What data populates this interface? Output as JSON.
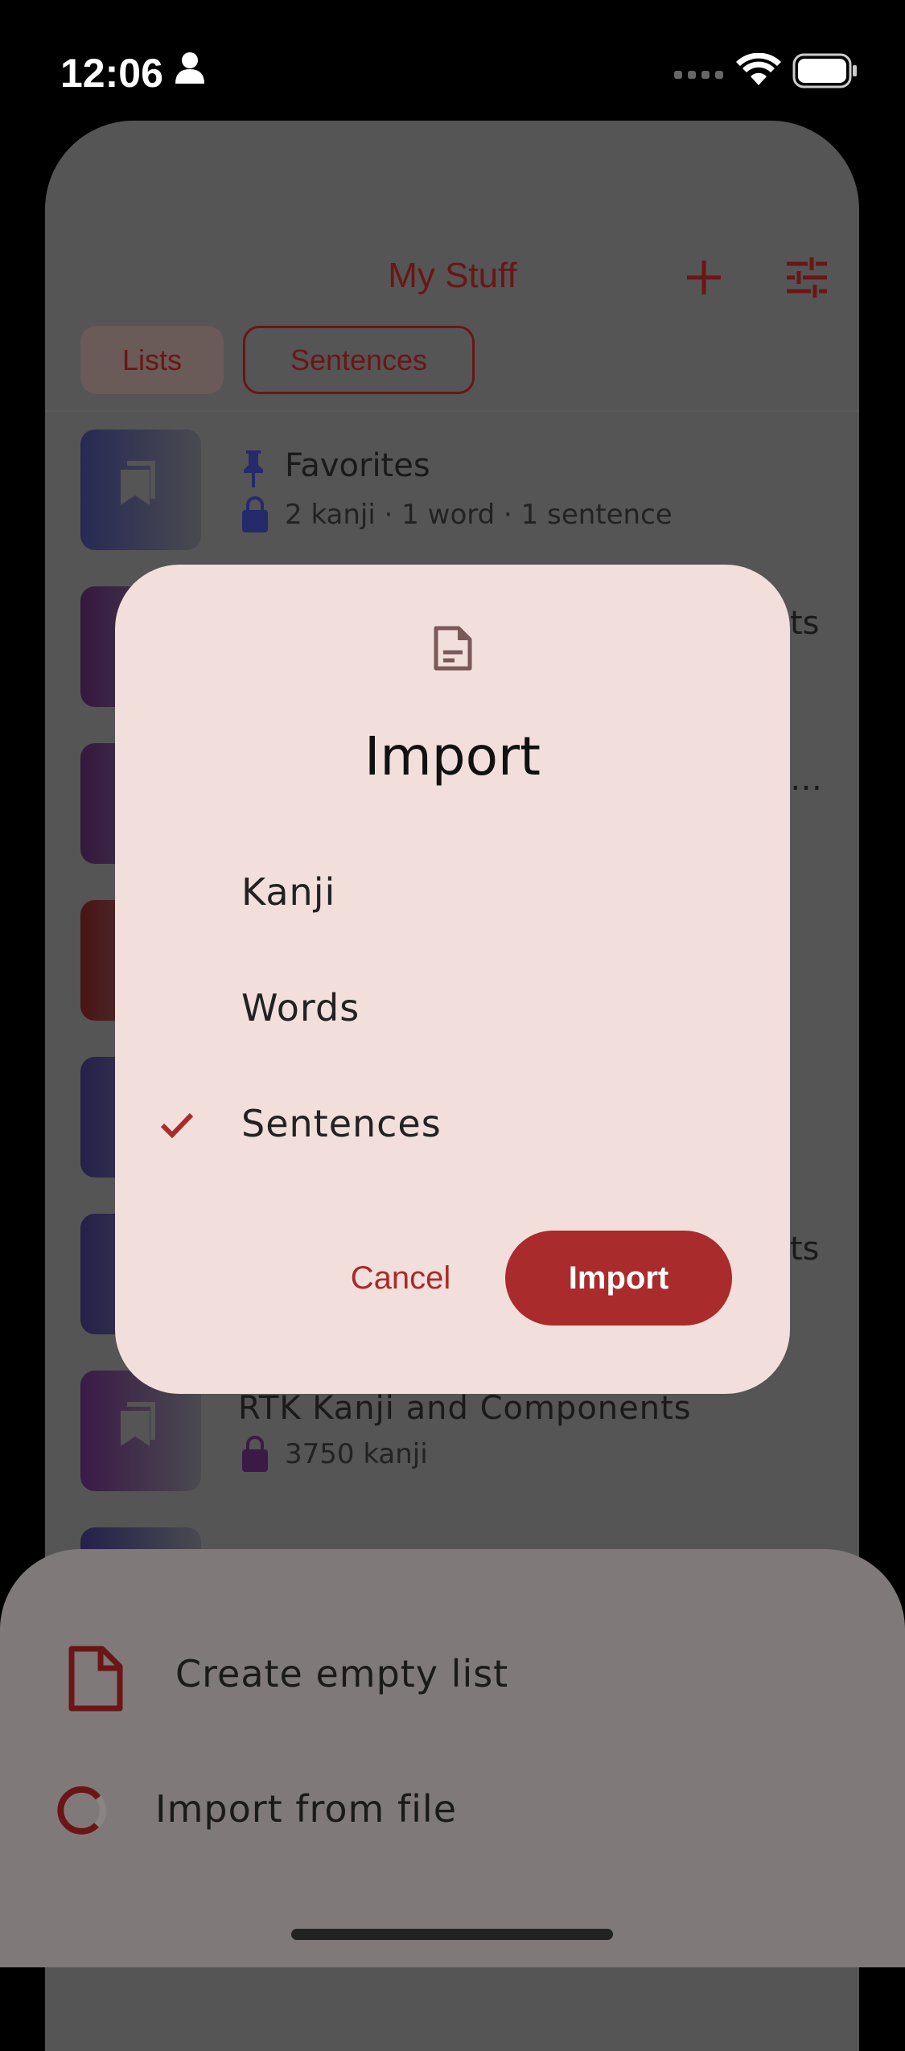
{
  "status_bar": {
    "time": "12:06"
  },
  "header": {
    "title": "My Stuff"
  },
  "tabs": [
    {
      "label": "Lists",
      "selected": true
    },
    {
      "label": "Sentences",
      "selected": false
    }
  ],
  "list": [
    {
      "title": "Favorites",
      "subtitle": "2 kanji · 1 word · 1 sentence",
      "color": "#272a55"
    },
    {
      "title_fragment": "ts",
      "color": "#35183f"
    },
    {
      "title_fragment": "…",
      "color": "#35183f"
    },
    {
      "color": "#4a1414"
    },
    {
      "color": "#25204a"
    },
    {
      "title_fragment": "ts",
      "color": "#25204a"
    },
    {
      "title": "RTK Kanji and Components",
      "subtitle": "3750 kanji",
      "color": "#3b1a47"
    },
    {
      "color": "#25204a"
    }
  ],
  "dialog": {
    "icon": "document-icon",
    "title": "Import",
    "options": [
      {
        "label": "Kanji",
        "checked": false
      },
      {
        "label": "Words",
        "checked": false
      },
      {
        "label": "Sentences",
        "checked": true
      }
    ],
    "cancel": "Cancel",
    "confirm": "Import",
    "accent": "#a92b2b"
  },
  "bottom_sheet": {
    "items": [
      {
        "label": "Create empty list",
        "icon": "file-icon"
      },
      {
        "label": "Import from file",
        "icon": "loading-spinner-icon"
      }
    ]
  }
}
